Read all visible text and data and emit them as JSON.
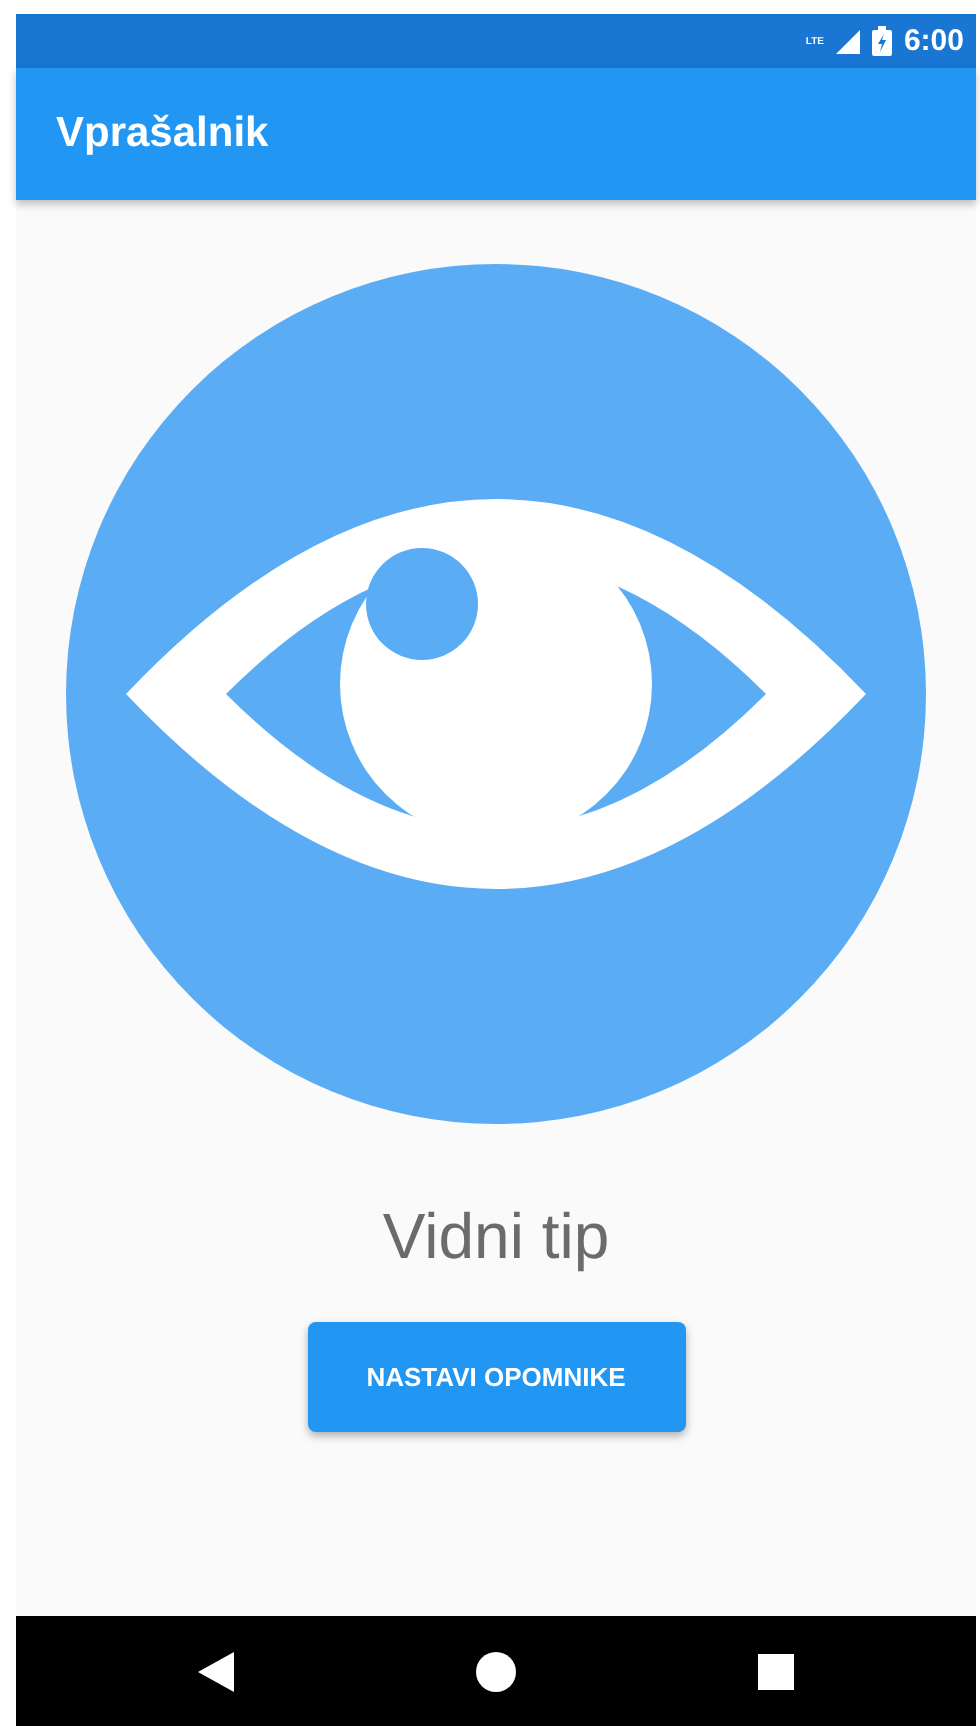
{
  "status_bar": {
    "network": "LTE",
    "time": "6:00"
  },
  "app_bar": {
    "title": "Vprašalnik"
  },
  "result": {
    "label": "Vidni tip"
  },
  "button": {
    "label": "NASTAVI OPOMNIKE"
  }
}
